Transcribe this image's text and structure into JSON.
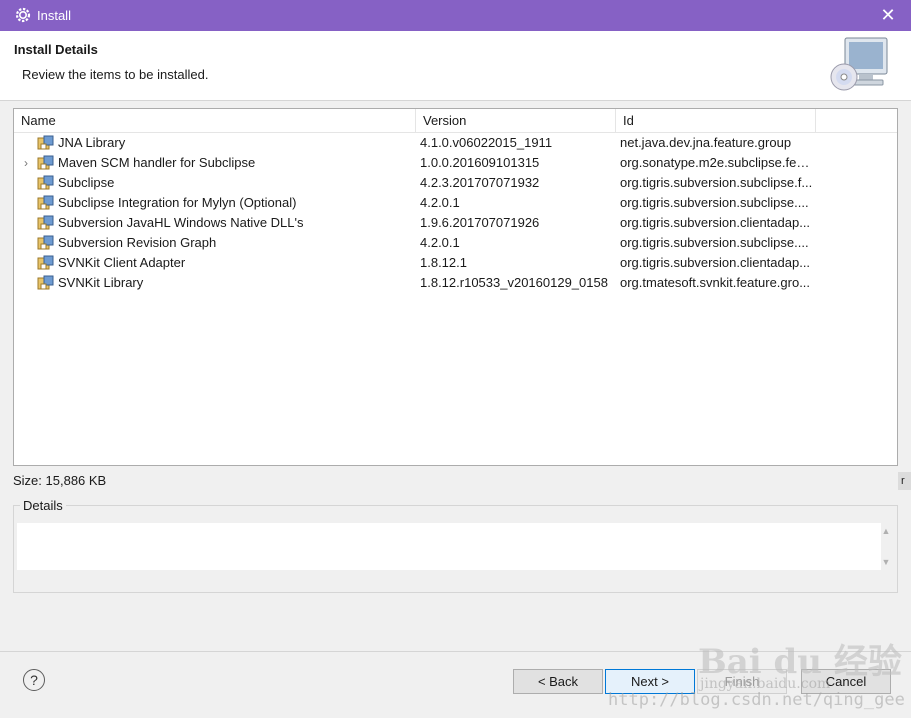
{
  "window": {
    "title": "Install",
    "close_glyph": "✕",
    "icon": "gear-icon"
  },
  "header": {
    "title": "Install Details",
    "subtitle": "Review the items to be installed.",
    "banner_icon": "install-computer-icon"
  },
  "table": {
    "columns": [
      "Name",
      "Version",
      "Id"
    ],
    "rows": [
      {
        "name": "JNA Library",
        "version": "4.1.0.v06022015_1911",
        "id": "net.java.dev.jna.feature.group",
        "expandable": false
      },
      {
        "name": "Maven SCM handler for Subclipse",
        "version": "1.0.0.201609101315",
        "id": "org.sonatype.m2e.subclipse.feat...",
        "expandable": true,
        "expander": "›"
      },
      {
        "name": "Subclipse",
        "version": "4.2.3.201707071932",
        "id": "org.tigris.subversion.subclipse.f...",
        "expandable": false
      },
      {
        "name": "Subclipse Integration for Mylyn (Optional)",
        "version": "4.2.0.1",
        "id": "org.tigris.subversion.subclipse....",
        "expandable": false
      },
      {
        "name": "Subversion JavaHL Windows Native DLL's",
        "version": "1.9.6.201707071926",
        "id": "org.tigris.subversion.clientadap...",
        "expandable": false
      },
      {
        "name": "Subversion Revision Graph",
        "version": "4.2.0.1",
        "id": "org.tigris.subversion.subclipse....",
        "expandable": false
      },
      {
        "name": "SVNKit Client Adapter",
        "version": "1.8.12.1",
        "id": "org.tigris.subversion.clientadap...",
        "expandable": false
      },
      {
        "name": "SVNKit Library",
        "version": "1.8.12.r10533_v20160129_0158",
        "id": "org.tmatesoft.svnkit.feature.gro...",
        "expandable": false
      }
    ],
    "row_icon": "feature-plugin-icon"
  },
  "size_label": "Size: 15,886 KB",
  "details": {
    "legend": "Details",
    "value": ""
  },
  "buttons": {
    "help": "?",
    "back": "< Back",
    "next": "Next >",
    "finish": "Finish",
    "cancel": "Cancel"
  },
  "watermark": {
    "brand": "Bai du 经验",
    "site": "jingyan.baidu.com",
    "url": "http://blog.csdn.net/qing_gee"
  },
  "edge_fragment": "r",
  "colors": {
    "titlebar": "#8661c5",
    "next_border": "#0078d7"
  }
}
